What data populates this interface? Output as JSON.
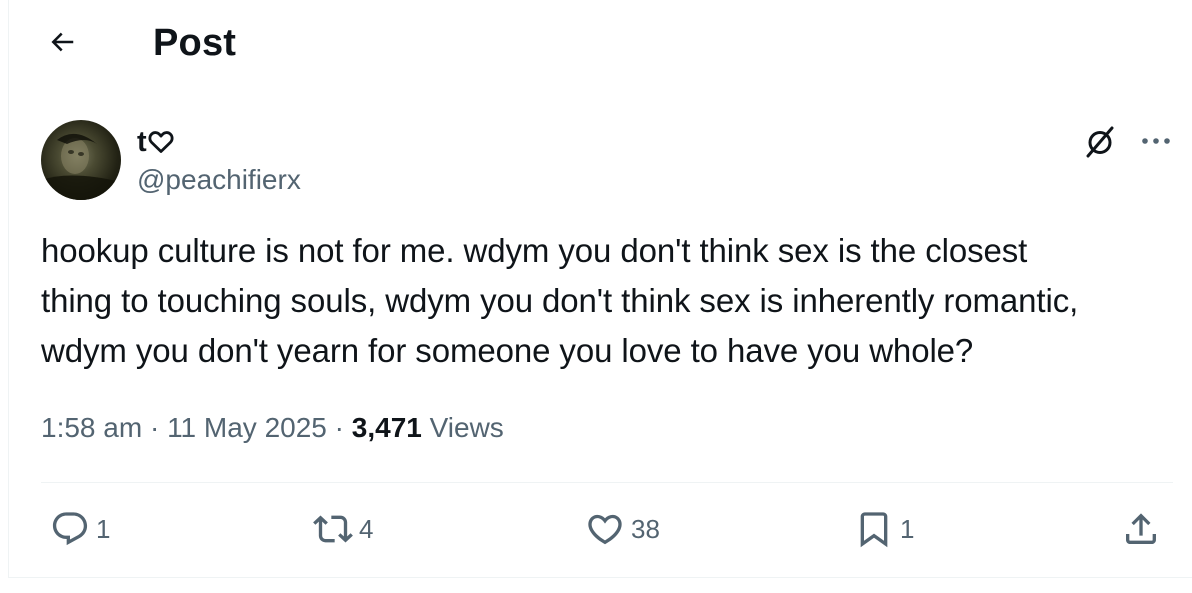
{
  "header": {
    "title": "Post"
  },
  "author": {
    "display_name": "t",
    "handle": "@peachifierx"
  },
  "post": {
    "text_lines": [
      "hookup culture is not for me. wdym you don't think sex is the closest",
      "thing to touching souls, wdym you don't think sex is inherently romantic,",
      "wdym you don't yearn for someone you love to have you whole?"
    ]
  },
  "meta": {
    "time": "1:58 am",
    "separator1": " · ",
    "date": "11 May 2025",
    "separator2": " · ",
    "views_count": "3,471",
    "views_label": " Views"
  },
  "actions": {
    "replies": "1",
    "reposts": "4",
    "likes": "38",
    "bookmarks": "1"
  },
  "icons": {
    "back": "arrow-left-icon",
    "heart_in_name": "heart-outline-icon",
    "grok": "grok-icon",
    "more": "more-dots-icon",
    "reply": "reply-icon",
    "repost": "repost-icon",
    "like": "heart-icon",
    "bookmark": "bookmark-icon",
    "share": "share-icon"
  },
  "colors": {
    "text_primary": "#0f1419",
    "text_secondary": "#536471",
    "divider": "#eff3f4"
  }
}
